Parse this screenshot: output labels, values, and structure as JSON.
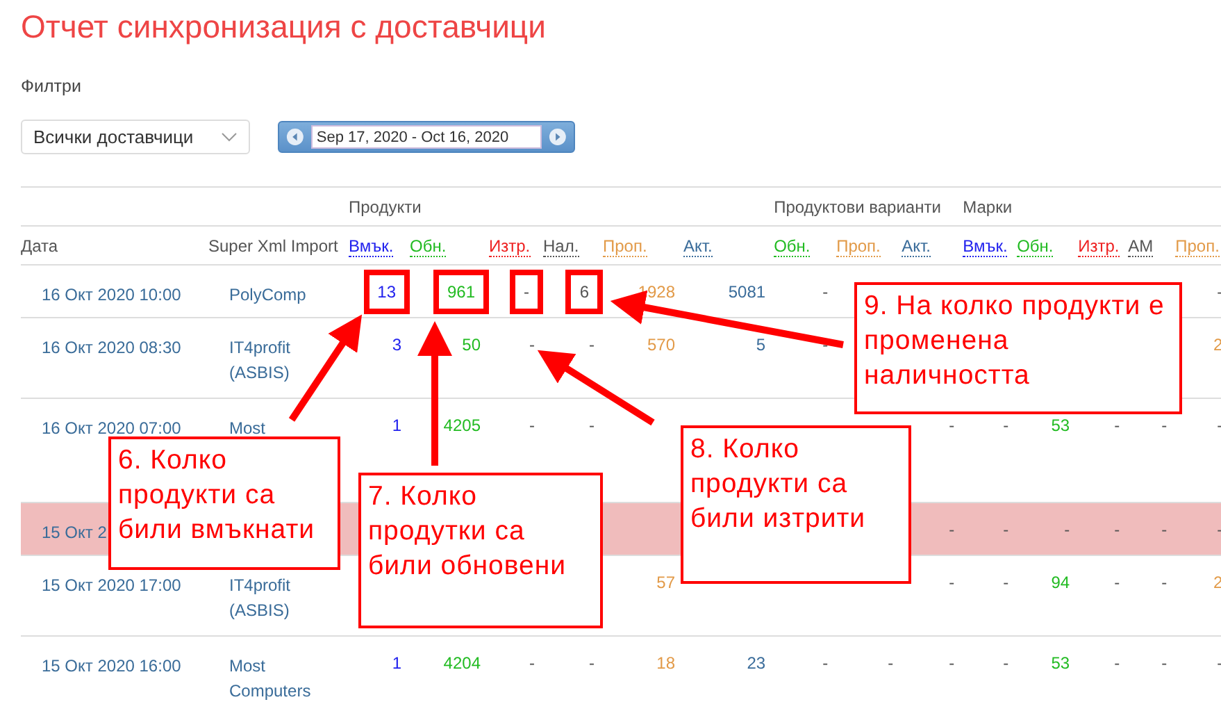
{
  "title": "Отчет синхронизация с доставчици",
  "filters": {
    "label": "Филтри",
    "supplier": {
      "value": "Всички доставчици"
    },
    "date_range": {
      "value": "Sep 17, 2020 - Oct 16, 2020"
    }
  },
  "table": {
    "groups": [
      {
        "label": "Продукти"
      },
      {
        "label": "Продуктови варианти"
      },
      {
        "label": "Марки"
      }
    ],
    "columns": [
      {
        "label": "Дата",
        "kind": "plain"
      },
      {
        "label": "Super Xml Import",
        "kind": "plain"
      },
      {
        "label": "Вмък.",
        "kind": "insert"
      },
      {
        "label": "Обн.",
        "kind": "update"
      },
      {
        "label": "Изтр.",
        "kind": "delete"
      },
      {
        "label": "Нал.",
        "kind": "stock"
      },
      {
        "label": "Проп.",
        "kind": "skip"
      },
      {
        "label": "Акт.",
        "kind": "active"
      },
      {
        "label": "Обн.",
        "kind": "update"
      },
      {
        "label": "Проп.",
        "kind": "skip"
      },
      {
        "label": "Акт.",
        "kind": "active"
      },
      {
        "label": "Вмък.",
        "kind": "insert"
      },
      {
        "label": "Обн.",
        "kind": "update"
      },
      {
        "label": "Изтр.",
        "kind": "delete"
      },
      {
        "label": "АМ",
        "kind": "am"
      },
      {
        "label": "Проп.",
        "kind": "skip"
      }
    ],
    "rows": [
      {
        "highlighted": false,
        "cells": [
          "16 Окт 2020 10:00",
          "PolyComp",
          {
            "text": "13",
            "boxed": true
          },
          {
            "text": "961",
            "boxed": true
          },
          {
            "text": "-",
            "boxed": true
          },
          {
            "text": "6",
            "boxed": true
          },
          "1928",
          "5081",
          "-",
          null,
          null,
          null,
          null,
          null,
          null,
          "-"
        ]
      },
      {
        "highlighted": false,
        "cells": [
          "16 Окт 2020 08:30",
          "IT4profit (ASBIS)",
          "3",
          "50",
          "-",
          "-",
          "570",
          "5",
          "-",
          null,
          null,
          null,
          null,
          null,
          null,
          "2"
        ]
      },
      {
        "highlighted": false,
        "cells": [
          "16 Окт 2020 07:00",
          "Most",
          "1",
          "4205",
          "-",
          "-",
          null,
          null,
          null,
          null,
          "-",
          "-",
          "53",
          "-",
          "-",
          "-"
        ]
      },
      {
        "highlighted": true,
        "cells": [
          "15 Окт 2",
          null,
          null,
          null,
          null,
          null,
          null,
          null,
          null,
          null,
          "-",
          "-",
          "-",
          "-",
          "-",
          "-"
        ]
      },
      {
        "highlighted": false,
        "cells": [
          "15 Окт 2020 17:00",
          "IT4profit (ASBIS)",
          null,
          null,
          null,
          null,
          "57",
          null,
          null,
          null,
          "-",
          "-",
          "94",
          "-",
          "-",
          "2"
        ]
      },
      {
        "highlighted": false,
        "cells": [
          "15 Окт 2020 16:00",
          "Most Computers",
          "1",
          "4204",
          "-",
          "-",
          "18",
          "23",
          "-",
          "-",
          "-",
          "-",
          "53",
          "-",
          "-",
          "-"
        ]
      }
    ]
  },
  "annotations": [
    {
      "text": "6. Колко продукти са били вмъкнати"
    },
    {
      "text": "7. Колко продутки са били обновени"
    },
    {
      "text": "8. Колко продукти са били изтрити"
    },
    {
      "text": "9. На колко продукти е променена наличността"
    }
  ]
}
